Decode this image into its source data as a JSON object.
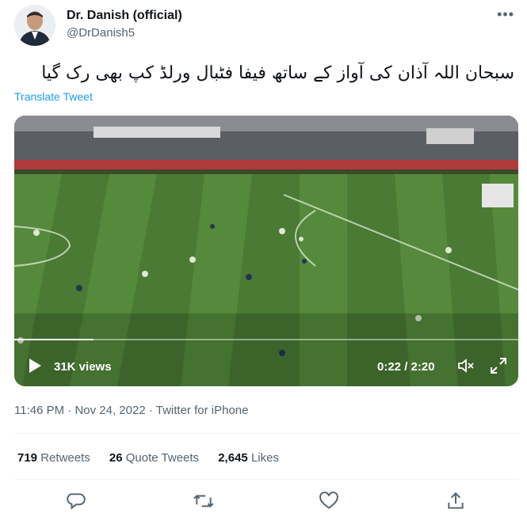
{
  "author": {
    "display_name": "Dr. Danish (official)",
    "handle": "@DrDanish5",
    "avatar_icon": "profile-photo"
  },
  "more_icon": "more-dots-icon",
  "tweet": {
    "text": "سبحان اللہ آذان کی آواز کے ساتھ فیفا فٹبال ورلڈ کپ بھی رک گیا",
    "translate_label": "Translate Tweet"
  },
  "video": {
    "views": "31K views",
    "time": "0:22 / 2:20",
    "progress_fraction": 0.157,
    "playing": false
  },
  "meta": {
    "time": "11:46 PM",
    "date": "Nov 24, 2022",
    "sep": "·",
    "source": "Twitter for iPhone"
  },
  "stats": {
    "retweets_count": "719",
    "retweets_label": "Retweets",
    "quotes_count": "26",
    "quotes_label": "Quote Tweets",
    "likes_count": "2,645",
    "likes_label": "Likes"
  },
  "colors": {
    "link": "#1d9bf0",
    "secondary": "#536471",
    "text": "#0f1419"
  },
  "actions": [
    "reply-icon",
    "retweet-icon",
    "like-icon",
    "share-icon"
  ]
}
